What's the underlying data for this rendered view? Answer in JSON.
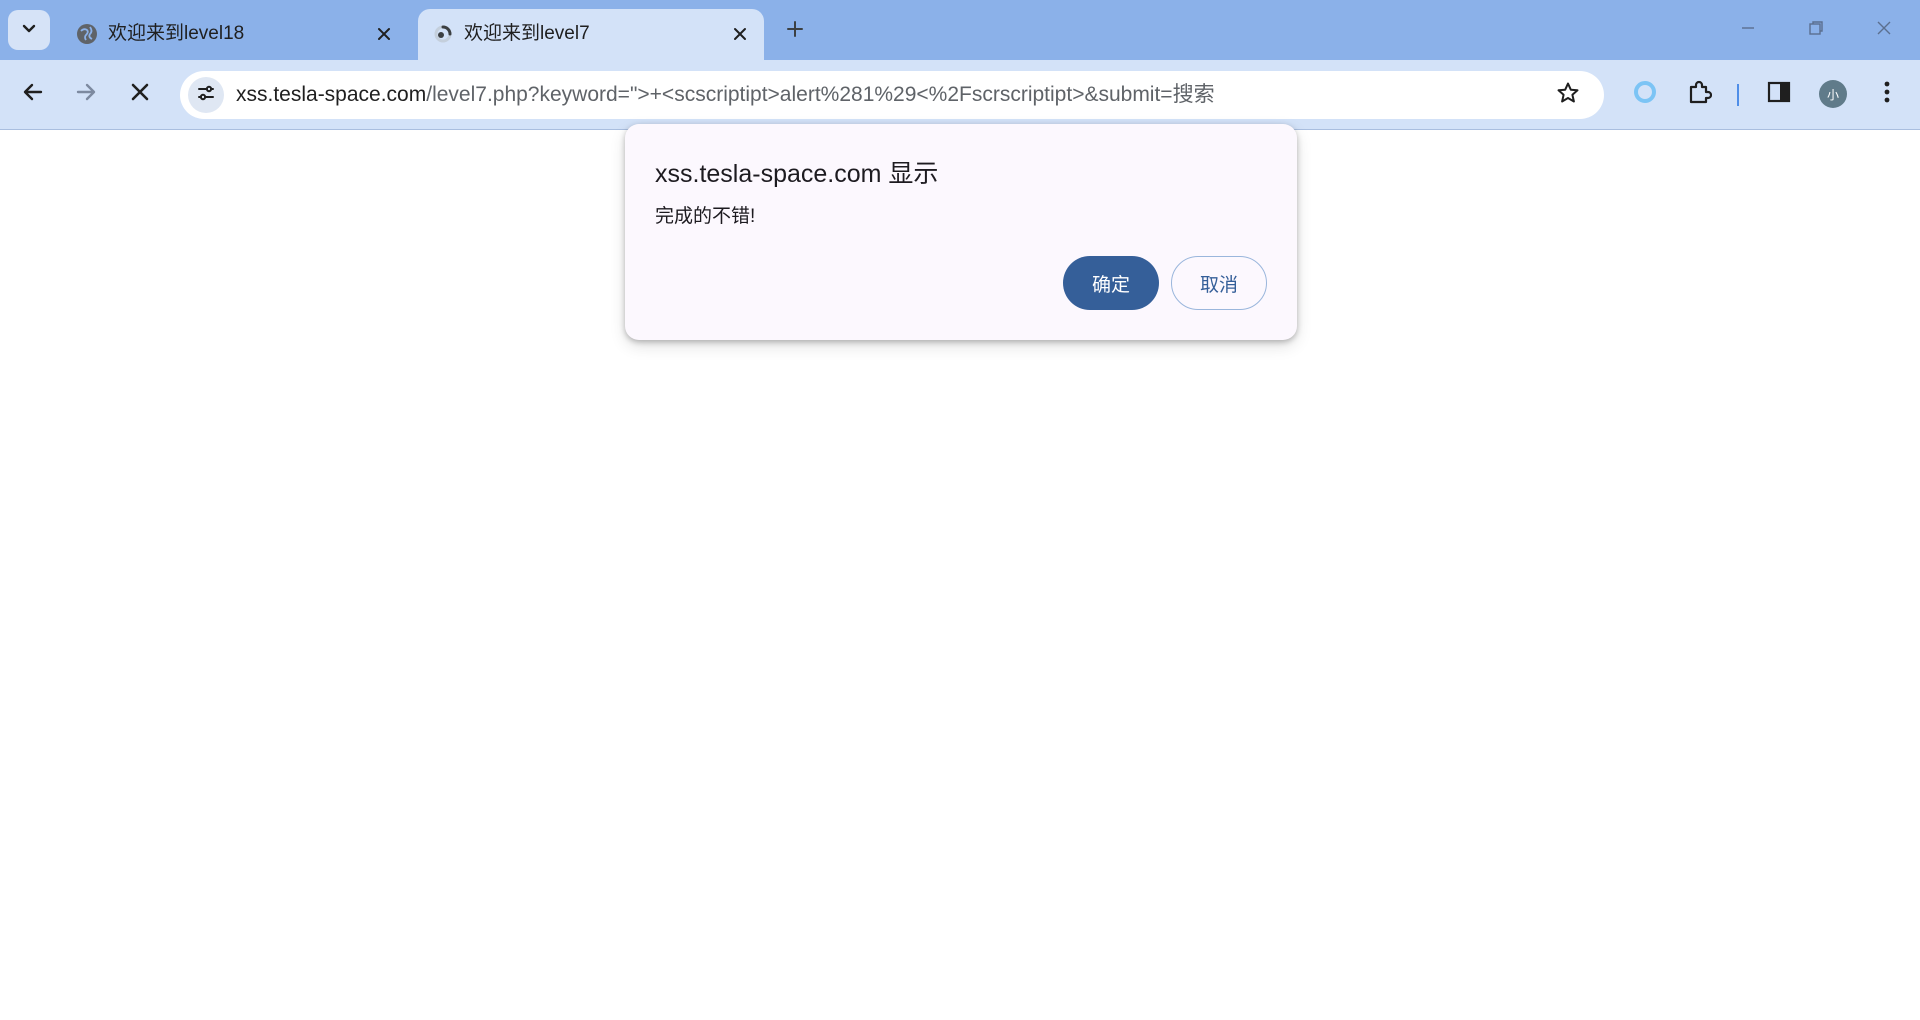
{
  "browser": {
    "tabs": [
      {
        "title": "欢迎来到level18",
        "active": false,
        "favicon": "globe-icon"
      },
      {
        "title": "欢迎来到level7",
        "active": true,
        "favicon": "loading-spinner-icon"
      }
    ],
    "url": {
      "host": "xss.tesla-space.com",
      "path": "/level7.php?keyword=\">+<scscriptipt>alert%281%29<%2Fscrscriptipt>&submit=搜索"
    },
    "profile_initial": "小",
    "colors": {
      "tabstrip": "#8bb1e9",
      "toolbar": "#d3e2f8",
      "accent": "#355f99"
    }
  },
  "dialog": {
    "title": "xss.tesla-space.com 显示",
    "message": "完成的不错!",
    "ok_label": "确定",
    "cancel_label": "取消"
  }
}
